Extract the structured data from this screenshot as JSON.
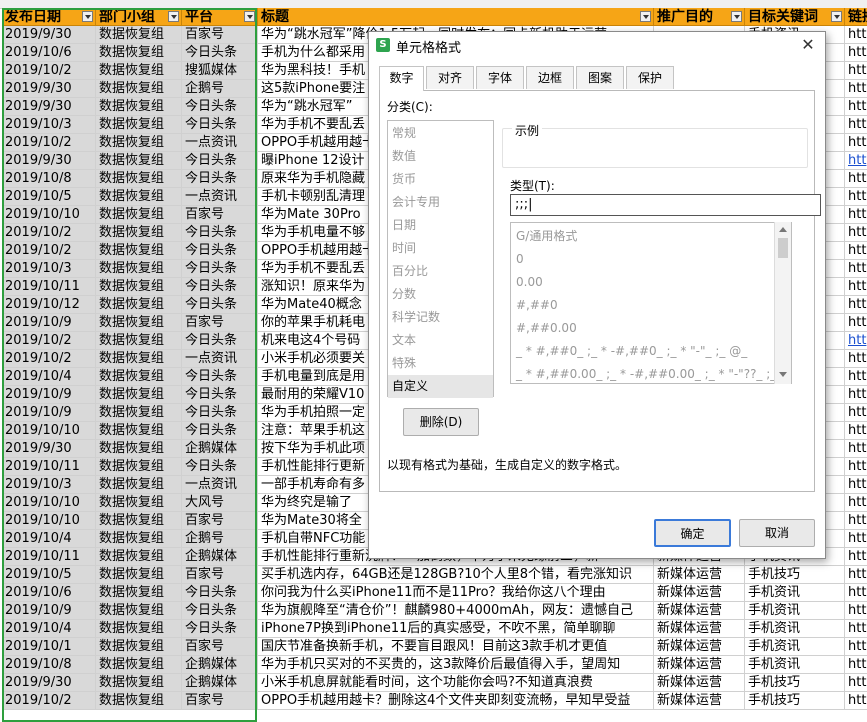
{
  "columns": [
    "发布日期",
    "部门小组",
    "平台",
    "标题",
    "推广目的",
    "目标关键词",
    "链接"
  ],
  "rows": [
    [
      "2019/9/30",
      "数据恢复组",
      "百家号",
      "华为“跳水冠军”降价1.5万起，同时发布：同卡新机助于运营",
      "",
      "手机资讯",
      "htt"
    ],
    [
      "2019/10/6",
      "数据恢复组",
      "今日头条",
      "手机为什么都采用",
      "",
      "",
      "htt"
    ],
    [
      "2019/10/2",
      "数据恢复组",
      "搜狐媒体",
      "华为黑科技！手机",
      "",
      "",
      "htt"
    ],
    [
      "2019/9/30",
      "数据恢复组",
      "企鹅号",
      "这5款iPhone要注",
      "",
      "",
      "htt"
    ],
    [
      "2019/9/30",
      "数据恢复组",
      "今日头条",
      "华为“跳水冠军”",
      "",
      "",
      "htt"
    ],
    [
      "2019/10/3",
      "数据恢复组",
      "今日头条",
      "华为手机不要乱丢",
      "",
      "",
      "htt"
    ],
    [
      "2019/10/2",
      "数据恢复组",
      "一点资讯",
      "OPPO手机越用越卡",
      "",
      "",
      "htt"
    ],
    [
      "2019/9/30",
      "数据恢复组",
      "今日头条",
      "曝iPhone 12设计",
      "",
      "",
      "htt"
    ],
    [
      "2019/10/8",
      "数据恢复组",
      "今日头条",
      "原来华为手机隐藏",
      "",
      "",
      "htt"
    ],
    [
      "2019/10/5",
      "数据恢复组",
      "一点资讯",
      "手机卡顿别乱清理",
      "",
      "",
      "htt"
    ],
    [
      "2019/10/10",
      "数据恢复组",
      "百家号",
      "华为Mate 30Pro",
      "",
      "",
      "htt"
    ],
    [
      "2019/10/2",
      "数据恢复组",
      "今日头条",
      "华为手机电量不够",
      "",
      "",
      "htt"
    ],
    [
      "2019/10/2",
      "数据恢复组",
      "今日头条",
      "OPPO手机越用越卡",
      "",
      "",
      "htt"
    ],
    [
      "2019/10/3",
      "数据恢复组",
      "今日头条",
      "华为手机不要乱丢",
      "",
      "",
      "htt"
    ],
    [
      "2019/10/11",
      "数据恢复组",
      "今日头条",
      "涨知识！原来华为",
      "",
      "",
      "htt"
    ],
    [
      "2019/10/12",
      "数据恢复组",
      "今日头条",
      "华为Mate40概念",
      "",
      "",
      "htt"
    ],
    [
      "2019/10/9",
      "数据恢复组",
      "百家号",
      "你的苹果手机耗电",
      "",
      "",
      "htt"
    ],
    [
      "2019/10/2",
      "数据恢复组",
      "今日头条",
      "机来电这4个号码",
      "",
      "",
      "htt"
    ],
    [
      "2019/10/2",
      "数据恢复组",
      "一点资讯",
      "小米手机必须要关",
      "",
      "",
      "htt"
    ],
    [
      "2019/10/4",
      "数据恢复组",
      "今日头条",
      "手机电量到底是用",
      "",
      "",
      "htt"
    ],
    [
      "2019/10/9",
      "数据恢复组",
      "今日头条",
      "最耐用的荣耀V10",
      "",
      "",
      "htt"
    ],
    [
      "2019/10/9",
      "数据恢复组",
      "今日头条",
      "华为手机拍照一定",
      "",
      "",
      "htt"
    ],
    [
      "2019/10/10",
      "数据恢复组",
      "今日头条",
      "注意：苹果手机这",
      "",
      "",
      "htt"
    ],
    [
      "2019/9/30",
      "数据恢复组",
      "企鹅媒体",
      "按下华为手机此项",
      "",
      "",
      "htt"
    ],
    [
      "2019/10/11",
      "数据恢复组",
      "今日头条",
      "手机性能排行更新",
      "",
      "",
      "htt"
    ],
    [
      "2019/10/3",
      "数据恢复组",
      "一点资讯",
      "一部手机寿命有多",
      "",
      "",
      "htt"
    ],
    [
      "2019/10/10",
      "数据恢复组",
      "大风号",
      "华为终究是输了",
      "",
      "",
      "htt"
    ],
    [
      "2019/10/10",
      "数据恢复组",
      "百家号",
      "华为Mate30将全",
      "",
      "",
      "htt"
    ],
    [
      "2019/10/4",
      "数据恢复组",
      "企鹅号",
      "手机自带NFC功能",
      "",
      "",
      "htt"
    ],
    [
      "2019/10/11",
      "数据恢复组",
      "企鹅媒体",
      "手机性能排行重新洗牌！一加倒数，华为小米无缘前三，新",
      "新媒体运营",
      "手机资讯",
      "htt"
    ],
    [
      "2019/10/5",
      "数据恢复组",
      "百家号",
      "买手机选内存，64GB还是128GB?10个人里8个错，看完涨知识",
      "新媒体运营",
      "手机技巧",
      "htt"
    ],
    [
      "2019/10/6",
      "数据恢复组",
      "今日头条",
      "你问我为什么买iPhone11而不是11Pro？我给你这八个理由",
      "新媒体运营",
      "手机资讯",
      "htt"
    ],
    [
      "2019/10/9",
      "数据恢复组",
      "今日头条",
      "华为旗舰降至“清仓价”！麒麟980+4000mAh，网友：遗憾自己",
      "新媒体运营",
      "手机资讯",
      "htt"
    ],
    [
      "2019/10/4",
      "数据恢复组",
      "今日头条",
      "iPhone7P换到iPhone11后的真实感受，不吹不黑，简单聊聊",
      "新媒体运营",
      "手机资讯",
      "htt"
    ],
    [
      "2019/10/1",
      "数据恢复组",
      "百家号",
      "国庆节准备换新手机，不要盲目跟风！目前这3款手机才更值",
      "新媒体运营",
      "手机资讯",
      "htt"
    ],
    [
      "2019/10/8",
      "数据恢复组",
      "企鹅媒体",
      "华为手机只买对的不买贵的，这3款降价后最值得入手，望周知",
      "新媒体运营",
      "手机资讯",
      "htt"
    ],
    [
      "2019/9/30",
      "数据恢复组",
      "企鹅媒体",
      "小米手机息屏就能看时间，这个功能你会吗?不知道真浪费",
      "新媒体运营",
      "手机技巧",
      "htt"
    ],
    [
      "2019/10/2",
      "数据恢复组",
      "百家号",
      "OPPO手机越用越卡？删除这4个文件夹即刻变流畅，早知早受益",
      "新媒体运营",
      "手机技巧",
      "htt"
    ]
  ],
  "dialog": {
    "title": "单元格格式",
    "close_label": "✕",
    "tabs": [
      "数字",
      "对齐",
      "字体",
      "边框",
      "图案",
      "保护"
    ],
    "category_label": "分类(C):",
    "categories": [
      "常规",
      "数值",
      "货币",
      "会计专用",
      "日期",
      "时间",
      "百分比",
      "分数",
      "科学记数",
      "文本",
      "特殊",
      "自定义"
    ],
    "selected_category": "自定义",
    "sample_label": "示例",
    "type_label": "类型(T):",
    "type_value": ";;;|",
    "formats": [
      "G/通用格式",
      "0",
      "0.00",
      "#,##0",
      "#,##0.00",
      "_ * #,##0_ ;_ * -#,##0_ ;_ * \"-\"_ ;_ @_",
      "_ * #,##0.00_ ;_ * -#,##0.00_ ;_ * \"-\"??_ ;_ @_"
    ],
    "delete_label": "删除(D)",
    "description": "以现有格式为基础，生成自定义的数字格式。",
    "ok_label": "确定",
    "cancel_label": "取消"
  },
  "colors": {
    "header": "#f6a516",
    "selection_border": "#2e9f3e",
    "selected_fill": "#d9d9d9",
    "link": "#1a4fcf",
    "primary_button_border": "#3b7ad9"
  }
}
